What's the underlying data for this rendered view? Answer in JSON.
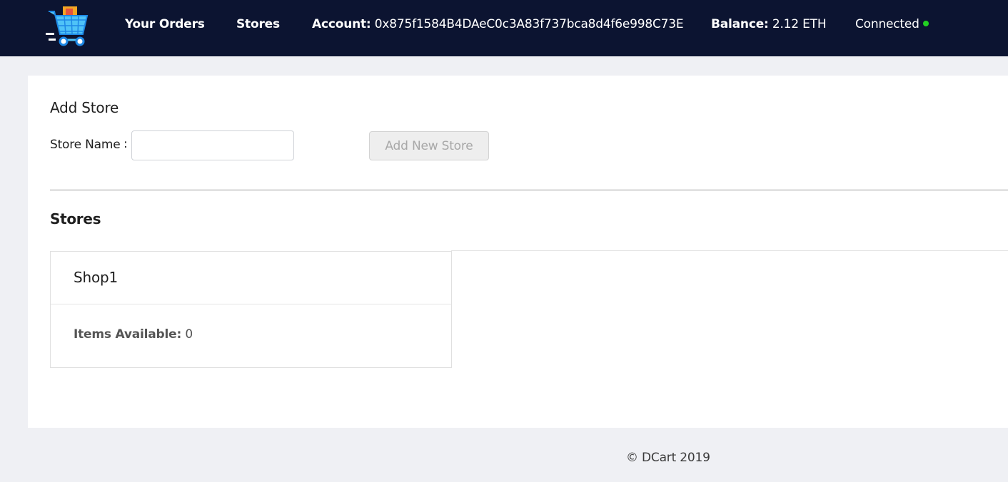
{
  "navbar": {
    "logo_icon": "shopping-cart-icon",
    "orders_link": "Your Orders",
    "stores_link": "Stores",
    "account_label": "Account:",
    "account_value": "0x875f1584B4DAeC0c3A83f737bca8d4f6e998C73E",
    "balance_label": "Balance:",
    "balance_value": "2.12 ETH",
    "status_text": "Connected",
    "status_color": "#22d022",
    "background_color": "#0c1431"
  },
  "add_store": {
    "title": "Add Store",
    "name_label": "Store Name",
    "name_colon": ":",
    "name_value": "",
    "button_label": "Add New Store"
  },
  "stores": {
    "title": "Stores",
    "items": [
      {
        "name": "Shop1",
        "items_label": "Items Available:",
        "items_count": "0"
      }
    ]
  },
  "footer": {
    "text": "© DCart 2019"
  }
}
